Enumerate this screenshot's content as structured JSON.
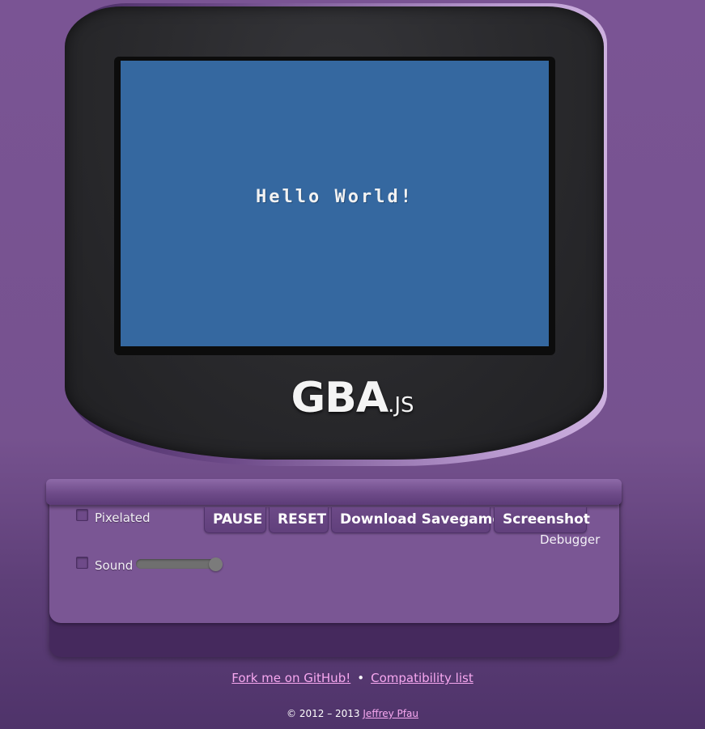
{
  "screen": {
    "text": "Hello World!",
    "background": "#3568a0"
  },
  "logo": {
    "main": "GBA",
    "sub": ".JS"
  },
  "controls": {
    "pixelated_label": "Pixelated",
    "pixelated_checked": false,
    "sound_label": "Sound",
    "sound_checked": false,
    "volume_fraction": 1.0,
    "buttons": {
      "pause": "PAUSE",
      "reset": "RESET",
      "download_savegame": "Download Savegame",
      "screenshot": "Screenshot"
    },
    "debugger_label": "Debugger"
  },
  "footer": {
    "github_link": "Fork me on GitHub!",
    "separator": "•",
    "compat_link": "Compatibility list",
    "copyright": "© 2012 – 2013",
    "author_link": "Jeffrey Pfau"
  },
  "colors": {
    "background": "#76528f",
    "device_shell": "#29292c",
    "link": "#f7a8f0"
  }
}
